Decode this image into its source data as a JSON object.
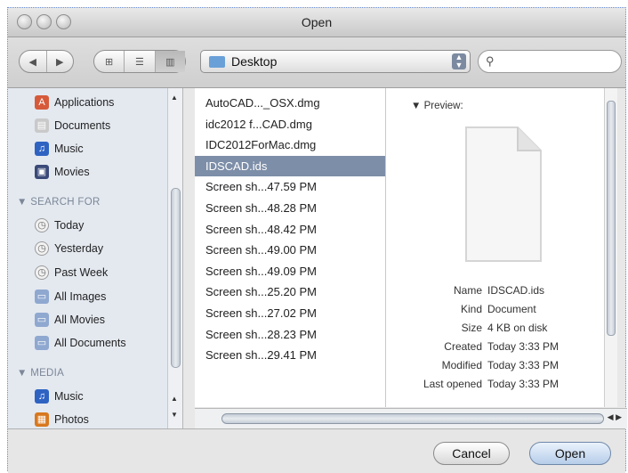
{
  "window": {
    "title": "Open"
  },
  "toolbar": {
    "back_icon": "back-arrow-icon",
    "forward_icon": "forward-arrow-icon",
    "location": "Desktop",
    "search_placeholder": ""
  },
  "sidebar": {
    "places": [
      {
        "label": "Applications",
        "icon": "applications-icon",
        "color": "#d65a3a"
      },
      {
        "label": "Documents",
        "icon": "documents-folder-icon",
        "color": "#c9c9c9"
      },
      {
        "label": "Music",
        "icon": "music-note-icon",
        "color": "#2f63c2"
      },
      {
        "label": "Movies",
        "icon": "movies-film-icon",
        "color": "#3a4a78"
      }
    ],
    "search_heading": "SEARCH FOR",
    "searches": [
      {
        "label": "Today",
        "icon": "clock-icon"
      },
      {
        "label": "Yesterday",
        "icon": "clock-icon"
      },
      {
        "label": "Past Week",
        "icon": "clock-icon"
      },
      {
        "label": "All Images",
        "icon": "smart-folder-icon"
      },
      {
        "label": "All Movies",
        "icon": "smart-folder-icon"
      },
      {
        "label": "All Documents",
        "icon": "smart-folder-icon"
      }
    ],
    "media_heading": "MEDIA",
    "media": [
      {
        "label": "Music",
        "icon": "music-note-icon",
        "color": "#2f63c2"
      },
      {
        "label": "Photos",
        "icon": "photos-icon",
        "color": "#d8781e"
      }
    ]
  },
  "files": [
    "AutoCAD..._OSX.dmg",
    "idc2012 f...CAD.dmg",
    "IDC2012ForMac.dmg",
    "IDSCAD.ids",
    "Screen sh...47.59 PM",
    "Screen sh...48.28 PM",
    "Screen sh...48.42 PM",
    "Screen sh...49.00 PM",
    "Screen sh...49.09 PM",
    "Screen sh...25.20 PM",
    "Screen sh...27.02 PM",
    "Screen sh...28.23 PM",
    "Screen sh...29.41 PM"
  ],
  "selected_file_index": 3,
  "preview": {
    "heading": "Preview:",
    "info": [
      {
        "key": "Name",
        "value": "IDSCAD.ids"
      },
      {
        "key": "Kind",
        "value": "Document"
      },
      {
        "key": "Size",
        "value": "4 KB on disk"
      },
      {
        "key": "Created",
        "value": "Today 3:33 PM"
      },
      {
        "key": "Modified",
        "value": "Today 3:33 PM"
      },
      {
        "key": "Last opened",
        "value": "Today 3:33 PM"
      }
    ]
  },
  "buttons": {
    "cancel": "Cancel",
    "open": "Open"
  },
  "colors": {
    "selection": "#7d8ea8",
    "sidebar_bg": "#e4e9f0",
    "default_button": "#b6cde9"
  }
}
